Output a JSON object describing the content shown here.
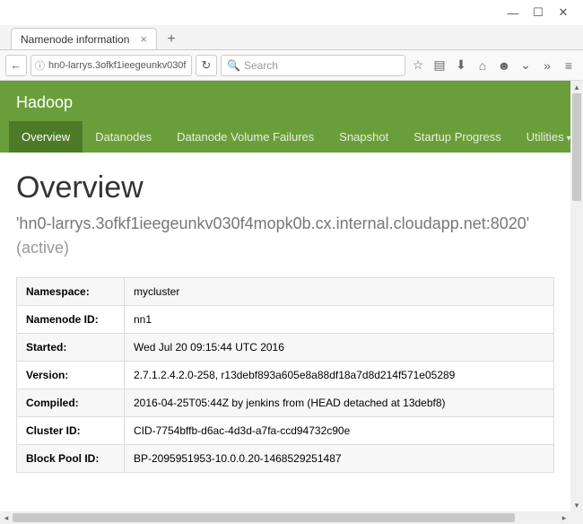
{
  "window": {
    "tab_title": "Namenode information"
  },
  "browser": {
    "url": "hn0-larrys.3ofkf1ieegeunkv030f",
    "search_placeholder": "Search"
  },
  "header": {
    "brand": "Hadoop",
    "nav": [
      {
        "label": "Overview"
      },
      {
        "label": "Datanodes"
      },
      {
        "label": "Datanode Volume Failures"
      },
      {
        "label": "Snapshot"
      },
      {
        "label": "Startup Progress"
      },
      {
        "label": "Utilities"
      }
    ]
  },
  "page": {
    "title": "Overview",
    "host": "'hn0-larrys.3ofkf1ieegeunkv030f4mopk0b.cx.internal.cloudapp.net:8020'",
    "status": "(active)"
  },
  "info": {
    "rows": [
      {
        "label": "Namespace:",
        "value": "mycluster"
      },
      {
        "label": "Namenode ID:",
        "value": "nn1"
      },
      {
        "label": "Started:",
        "value": "Wed Jul 20 09:15:44 UTC 2016"
      },
      {
        "label": "Version:",
        "value": "2.7.1.2.4.2.0-258, r13debf893a605e8a88df18a7d8d214f571e05289"
      },
      {
        "label": "Compiled:",
        "value": "2016-04-25T05:44Z by jenkins from (HEAD detached at 13debf8)"
      },
      {
        "label": "Cluster ID:",
        "value": "CID-7754bffb-d6ac-4d3d-a7fa-ccd94732c90e"
      },
      {
        "label": "Block Pool ID:",
        "value": "BP-2095951953-10.0.0.20-1468529251487"
      }
    ]
  }
}
